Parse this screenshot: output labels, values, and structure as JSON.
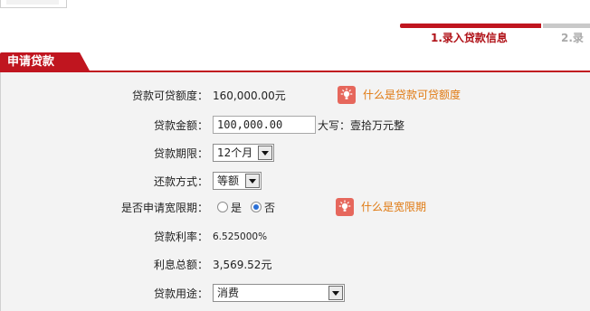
{
  "steps": [
    {
      "label": "1.录入贷款信息"
    },
    {
      "label": "2.录"
    }
  ],
  "tab": {
    "label": "申请贷款"
  },
  "form": {
    "available_credit": {
      "label": "贷款可贷额度：",
      "value": "160,000.00元",
      "help_text": "什么是贷款可贷额度",
      "help_icon": "lightbulb-icon"
    },
    "loan_amount": {
      "label": "贷款金额：",
      "value": "100,000.00",
      "capital_text": "大写：壹拾万元整"
    },
    "loan_term": {
      "label": "贷款期限：",
      "selected": "12个月"
    },
    "repayment_method": {
      "label": "还款方式：",
      "selected": "等额"
    },
    "grace_period": {
      "label": "是否申请宽限期：",
      "options": [
        "是",
        "否"
      ],
      "selected": "否",
      "help_text": "什么是宽限期",
      "help_icon": "lightbulb-icon"
    },
    "interest_rate": {
      "label": "贷款利率：",
      "value": "6.525000%"
    },
    "total_interest": {
      "label": "利息总额：",
      "value": "3,569.52元"
    },
    "loan_purpose": {
      "label": "贷款用途：",
      "selected": "消费"
    }
  },
  "colors": {
    "brand_red": "#c0151f",
    "help_orange": "#e07a12",
    "help_icon_bg": "#e6675c",
    "panel_bg": "#f3f3f3"
  }
}
